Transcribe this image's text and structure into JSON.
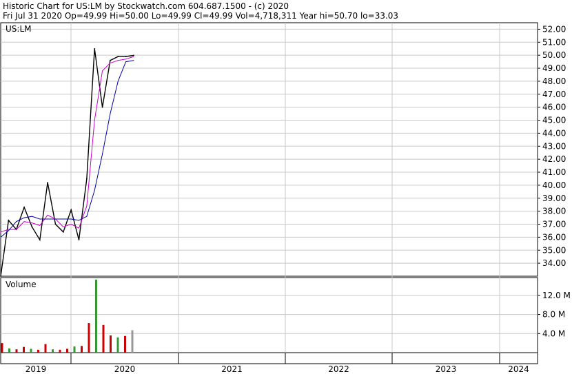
{
  "header": {
    "title": "Historic Chart for US:LM by Stockwatch.com 604.687.1500 - (c) 2020",
    "quote": "Fri Jul 31 2020  Op=49.99  Hi=50.00  Lo=49.99  Cl=49.99  Vol=4,718,311  Year hi=50.70  lo=33.03"
  },
  "colors": {
    "price": "#000000",
    "ma_fast": "#cc00cc",
    "ma_slow": "#0000aa",
    "volume_up": "#339933",
    "volume_down": "#cc0000",
    "volume_last": "#999999",
    "grid": "#c8c8c8"
  },
  "chart_data": [
    {
      "type": "line",
      "panel": "price",
      "title": "US:LM",
      "ylim": [
        33.0,
        52.5
      ],
      "ytick_labels": [
        "52.00",
        "51.00",
        "50.00",
        "49.00",
        "48.00",
        "47.00",
        "46.00",
        "45.00",
        "44.00",
        "43.00",
        "42.00",
        "41.00",
        "40.00",
        "39.00",
        "38.00",
        "37.00",
        "36.00",
        "35.00",
        "34.00"
      ],
      "ytick_values": [
        52,
        51,
        50,
        49,
        48,
        47,
        46,
        45,
        44,
        43,
        42,
        41,
        40,
        39,
        38,
        37,
        36,
        35,
        34
      ],
      "xtick_labels": [
        "2019",
        "2020",
        "2021",
        "2022",
        "2023",
        "2024"
      ],
      "x": [
        "2019-02",
        "2019-03",
        "2019-04",
        "2019-05",
        "2019-06",
        "2019-07",
        "2019-08",
        "2019-09",
        "2019-10",
        "2019-11",
        "2019-12",
        "2020-01",
        "2020-02",
        "2020-03",
        "2020-04",
        "2020-05",
        "2020-06",
        "2020-07"
      ],
      "series": [
        {
          "values": [
            33.0,
            37.3,
            36.6,
            38.3,
            36.8,
            35.8,
            40.2,
            37.0,
            36.4,
            38.1,
            35.8,
            40.5,
            50.5,
            46.0,
            49.6,
            49.9,
            49.9,
            49.99
          ]
        },
        {
          "values": [
            36.4,
            36.6,
            36.6,
            37.2,
            37.1,
            36.9,
            37.7,
            37.4,
            36.8,
            37.0,
            36.7,
            38.4,
            45.0,
            48.8,
            49.4,
            49.6,
            49.7,
            49.9
          ]
        },
        {
          "values": [
            36.0,
            36.5,
            37.2,
            37.5,
            37.6,
            37.4,
            37.4,
            37.4,
            37.4,
            37.4,
            37.3,
            37.6,
            39.6,
            42.4,
            45.5,
            48.0,
            49.5,
            49.6
          ]
        }
      ]
    },
    {
      "type": "bar",
      "panel": "volume",
      "title": "Volume",
      "ylim": [
        0,
        15.3
      ],
      "ytick_labels": [
        "12.0 M",
        "8.0 M",
        "4.0 M"
      ],
      "ytick_values": [
        12,
        8,
        4
      ],
      "x": [
        "2019-02",
        "2019-03",
        "2019-04",
        "2019-05",
        "2019-06",
        "2019-07",
        "2019-08",
        "2019-09",
        "2019-10",
        "2019-11",
        "2019-12",
        "2020-01",
        "2020-02",
        "2020-02b",
        "2020-03",
        "2020-04",
        "2020-05",
        "2020-06",
        "2020-07"
      ],
      "values": [
        2.0,
        0.9,
        0.7,
        1.2,
        0.8,
        0.6,
        1.8,
        0.7,
        0.6,
        0.8,
        1.3,
        1.4,
        6.2,
        15.3,
        5.8,
        3.6,
        3.2,
        3.5,
        4.7
      ]
    }
  ]
}
